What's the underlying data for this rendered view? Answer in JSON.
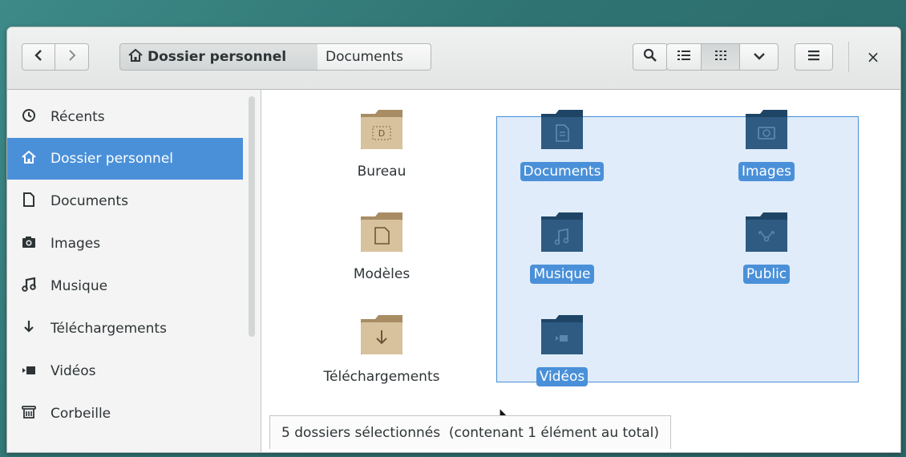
{
  "header": {
    "back_icon": "chevron-left",
    "forward_icon": "chevron-right",
    "breadcrumbs": [
      {
        "label": "Dossier personnel",
        "icon": "home"
      },
      {
        "label": "Documents"
      }
    ],
    "search_icon": "search",
    "list_view_icon": "list",
    "grid_view_icon": "grid",
    "view_options_icon": "chevron-down",
    "menu_icon": "hamburger",
    "close_label": "×"
  },
  "sidebar": {
    "items": [
      {
        "label": "Récents",
        "icon": "clock"
      },
      {
        "label": "Dossier personnel",
        "icon": "home",
        "active": true
      },
      {
        "label": "Documents",
        "icon": "document"
      },
      {
        "label": "Images",
        "icon": "camera"
      },
      {
        "label": "Musique",
        "icon": "music"
      },
      {
        "label": "Téléchargements",
        "icon": "download"
      },
      {
        "label": "Vidéos",
        "icon": "video"
      },
      {
        "label": "Corbeille",
        "icon": "trash"
      }
    ]
  },
  "files": [
    {
      "label": "Bureau",
      "icon": "desktop-folder",
      "selected": false
    },
    {
      "label": "Modèles",
      "icon": "templates-folder",
      "selected": false
    },
    {
      "label": "Téléchargements",
      "icon": "downloads-folder",
      "selected": false
    },
    {
      "label": "Documents",
      "icon": "documents-folder",
      "selected": true
    },
    {
      "label": "Musique",
      "icon": "music-folder",
      "selected": true
    },
    {
      "label": "Vidéos",
      "icon": "videos-folder",
      "selected": true
    },
    {
      "label": "Images",
      "icon": "pictures-folder",
      "selected": true
    },
    {
      "label": "Public",
      "icon": "public-folder",
      "selected": true
    }
  ],
  "status": {
    "text": "5 dossiers sélectionnés  (contenant 1 élément au total)"
  },
  "colors": {
    "accent": "#4a90d9",
    "folder_tan": "#d8c29d",
    "folder_blue": "#2f5b82"
  }
}
